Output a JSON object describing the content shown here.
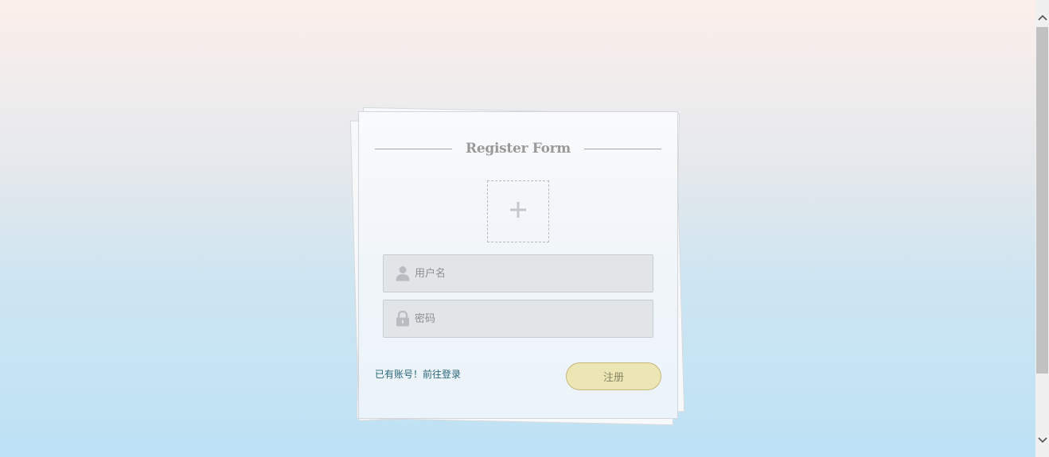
{
  "form": {
    "title": "Register Form",
    "avatar_upload_icon": "plus-icon",
    "username": {
      "icon": "user-icon",
      "placeholder": "用户名",
      "value": ""
    },
    "password": {
      "icon": "lock-icon",
      "placeholder": "密码",
      "value": ""
    },
    "login_link_label": "已有账号！前往登录",
    "submit_label": "注册"
  },
  "colors": {
    "title": "#999999",
    "link": "#2a6478",
    "button_bg": "#ece5b4",
    "field_bg": "#e1e5e8"
  }
}
